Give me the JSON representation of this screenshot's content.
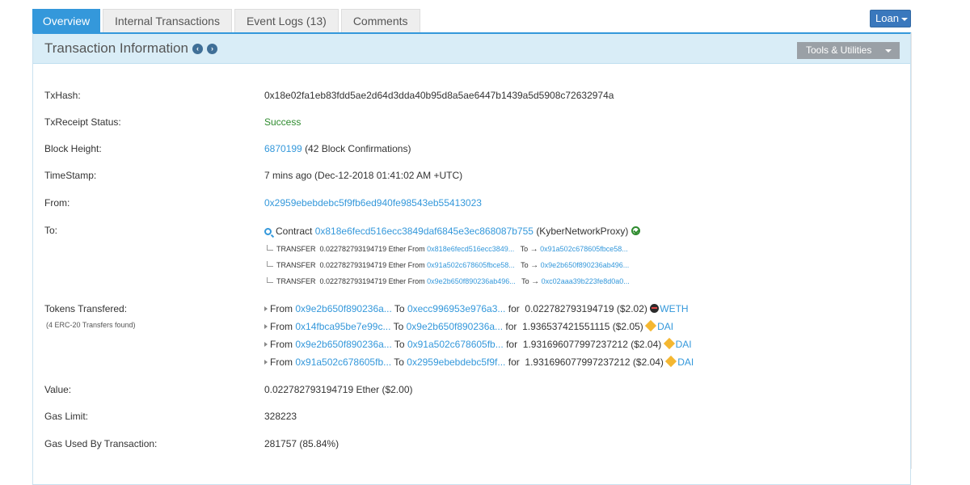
{
  "tabs": [
    {
      "label": "Overview",
      "active": true
    },
    {
      "label": "Internal Transactions"
    },
    {
      "label": "Event Logs (13)"
    },
    {
      "label": "Comments"
    }
  ],
  "loan_label": "Loan",
  "panel": {
    "title": "Transaction Information",
    "tools_label": "Tools & Utilities",
    "nav_prev_icon": "‹",
    "nav_next_icon": "›"
  },
  "details": {
    "txhash": {
      "label": "TxHash:",
      "value": "0x18e02fa1eb83fdd5ae2d64d3dda40b95d8a5ae6447b1439a5d5908c72632974a"
    },
    "status": {
      "label": "TxReceipt Status:",
      "value": "Success"
    },
    "block": {
      "label": "Block Height:",
      "value": "6870199",
      "confirmations": "(42 Block Confirmations)"
    },
    "timestamp": {
      "label": "TimeStamp:",
      "value": "7 mins ago (Dec-12-2018 01:41:02 AM +UTC)"
    },
    "from": {
      "label": "From:",
      "value": "0x2959ebebdebc5f9fb6ed940fe98543eb55413023"
    },
    "to": {
      "label": "To:",
      "prefix": "Contract",
      "address": "0x818e6fecd516ecc3849daf6845e3ec868087b755",
      "name": "(KyberNetworkProxy)",
      "transfers": [
        {
          "type": "TRANSFER",
          "amount": "0.022782793194719 Ether",
          "from_word": "From",
          "from": "0x818e6fecd516ecc3849...",
          "to_word": "To",
          "to": "0x91a502c678605fbce58..."
        },
        {
          "type": "TRANSFER",
          "amount": "0.022782793194719 Ether",
          "from_word": "From",
          "from": "0x91a502c678605fbce58...",
          "to_word": "To",
          "to": "0x9e2b650f890236ab496..."
        },
        {
          "type": "TRANSFER",
          "amount": "0.022782793194719 Ether",
          "from_word": "From",
          "from": "0x9e2b650f890236ab496...",
          "to_word": "To",
          "to": "0xc02aaa39b223fe8d0a0..."
        }
      ]
    },
    "tokens": {
      "label": "Tokens Transfered:",
      "note": "(4 ERC-20 Transfers found)",
      "rows": [
        {
          "from_word": "From",
          "from": "0x9e2b650f890236a...",
          "to_word": "To",
          "to": "0xecc996953e976a3...",
          "for_word": "for",
          "amount": "0.022782793194719 ($2.02)",
          "token": "WETH",
          "icon": "weth-icon"
        },
        {
          "from_word": "From",
          "from": "0x14fbca95be7e99c...",
          "to_word": "To",
          "to": "0x9e2b650f890236a...",
          "for_word": "for",
          "amount": "1.936537421551115 ($2.05)",
          "token": "DAI",
          "icon": "dai-icon"
        },
        {
          "from_word": "From",
          "from": "0x9e2b650f890236a...",
          "to_word": "To",
          "to": "0x91a502c678605fb...",
          "for_word": "for",
          "amount": "1.931696077997237212 ($2.04)",
          "token": "DAI",
          "icon": "dai-icon"
        },
        {
          "from_word": "From",
          "from": "0x91a502c678605fb...",
          "to_word": "To",
          "to": "0x2959ebebdebc5f9f...",
          "for_word": "for",
          "amount": "1.931696077997237212 ($2.04)",
          "token": "DAI",
          "icon": "dai-icon"
        }
      ]
    },
    "value": {
      "label": "Value:",
      "value": "0.022782793194719 Ether ($2.00)"
    },
    "gas_limit": {
      "label": "Gas Limit:",
      "value": "328223"
    },
    "gas_used": {
      "label": "Gas Used By Transaction:",
      "value": "281757 (85.84%)"
    }
  },
  "colors": {
    "accent": "#3498db",
    "success": "#2e8b2e",
    "header_bg": "#d9edf7"
  }
}
